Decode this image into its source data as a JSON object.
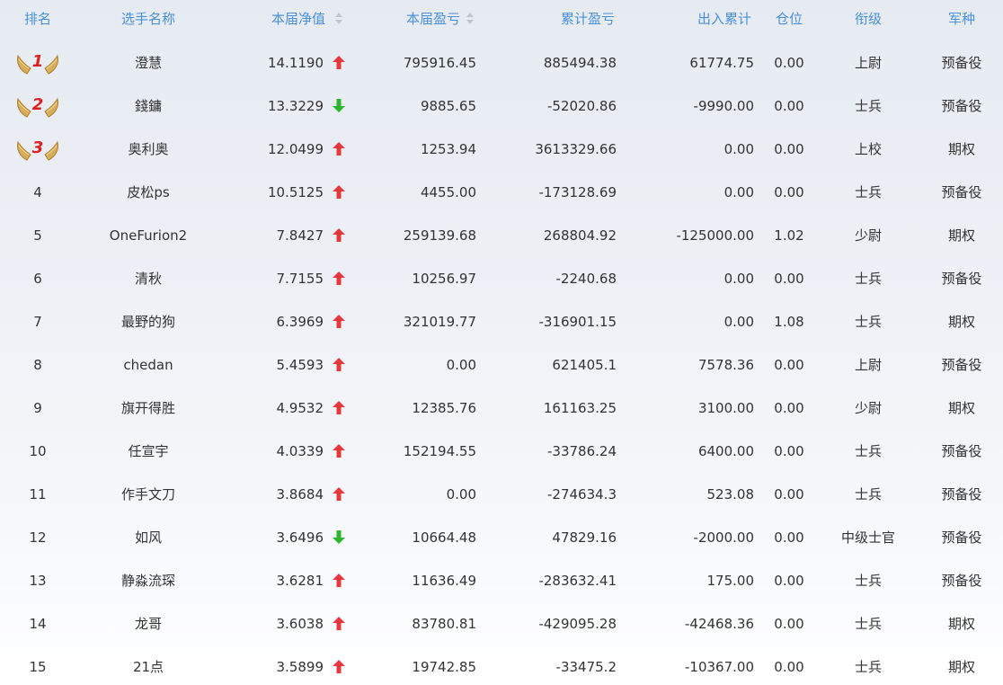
{
  "columns": {
    "rank": "排名",
    "name": "选手名称",
    "nav": "本届净值",
    "pl": "本届盈亏",
    "cum_pl": "累计盈亏",
    "io": "出入累计",
    "position": "仓位",
    "title": "衔级",
    "corps": "军种"
  },
  "colors": {
    "header_text": "#4a90d9",
    "up_arrow": "#e8383d",
    "down_arrow": "#2db52d",
    "medal_gold": "#c89a45",
    "medal_number": "#e02020"
  },
  "rows": [
    {
      "rank": "1",
      "name": "澄慧",
      "nav": "14.1190",
      "trend": "up",
      "pl": "795916.45",
      "cum_pl": "885494.38",
      "io": "61774.75",
      "position": "0.00",
      "title": "上尉",
      "corps": "预备役"
    },
    {
      "rank": "2",
      "name": "錢鏞",
      "nav": "13.3229",
      "trend": "down",
      "pl": "9885.65",
      "cum_pl": "-52020.86",
      "io": "-9990.00",
      "position": "0.00",
      "title": "士兵",
      "corps": "预备役"
    },
    {
      "rank": "3",
      "name": "奥利奥",
      "nav": "12.0499",
      "trend": "up",
      "pl": "1253.94",
      "cum_pl": "3613329.66",
      "io": "0.00",
      "position": "0.00",
      "title": "上校",
      "corps": "期权"
    },
    {
      "rank": "4",
      "name": "皮松ps",
      "nav": "10.5125",
      "trend": "up",
      "pl": "4455.00",
      "cum_pl": "-173128.69",
      "io": "0.00",
      "position": "0.00",
      "title": "士兵",
      "corps": "预备役"
    },
    {
      "rank": "5",
      "name": "OneFurion2",
      "nav": "7.8427",
      "trend": "up",
      "pl": "259139.68",
      "cum_pl": "268804.92",
      "io": "-125000.00",
      "position": "1.02",
      "title": "少尉",
      "corps": "期权"
    },
    {
      "rank": "6",
      "name": "清秋",
      "nav": "7.7155",
      "trend": "up",
      "pl": "10256.97",
      "cum_pl": "-2240.68",
      "io": "0.00",
      "position": "0.00",
      "title": "士兵",
      "corps": "预备役"
    },
    {
      "rank": "7",
      "name": "最野的狗",
      "nav": "6.3969",
      "trend": "up",
      "pl": "321019.77",
      "cum_pl": "-316901.15",
      "io": "0.00",
      "position": "1.08",
      "title": "士兵",
      "corps": "期权"
    },
    {
      "rank": "8",
      "name": "chedan",
      "nav": "5.4593",
      "trend": "up",
      "pl": "0.00",
      "cum_pl": "621405.1",
      "io": "7578.36",
      "position": "0.00",
      "title": "上尉",
      "corps": "预备役"
    },
    {
      "rank": "9",
      "name": "旗开得胜",
      "nav": "4.9532",
      "trend": "up",
      "pl": "12385.76",
      "cum_pl": "161163.25",
      "io": "3100.00",
      "position": "0.00",
      "title": "少尉",
      "corps": "期权"
    },
    {
      "rank": "10",
      "name": "任宣宇",
      "nav": "4.0339",
      "trend": "up",
      "pl": "152194.55",
      "cum_pl": "-33786.24",
      "io": "6400.00",
      "position": "0.00",
      "title": "士兵",
      "corps": "预备役"
    },
    {
      "rank": "11",
      "name": "作手文刀",
      "nav": "3.8684",
      "trend": "up",
      "pl": "0.00",
      "cum_pl": "-274634.3",
      "io": "523.08",
      "position": "0.00",
      "title": "士兵",
      "corps": "预备役"
    },
    {
      "rank": "12",
      "name": "如风",
      "nav": "3.6496",
      "trend": "down",
      "pl": "10664.48",
      "cum_pl": "47829.16",
      "io": "-2000.00",
      "position": "0.00",
      "title": "中级士官",
      "corps": "预备役"
    },
    {
      "rank": "13",
      "name": "静淼流琛",
      "nav": "3.6281",
      "trend": "up",
      "pl": "11636.49",
      "cum_pl": "-283632.41",
      "io": "175.00",
      "position": "0.00",
      "title": "士兵",
      "corps": "预备役"
    },
    {
      "rank": "14",
      "name": "龙哥",
      "nav": "3.6038",
      "trend": "up",
      "pl": "83780.81",
      "cum_pl": "-429095.28",
      "io": "-42468.36",
      "position": "0.00",
      "title": "士兵",
      "corps": "期权"
    },
    {
      "rank": "15",
      "name": "21点",
      "nav": "3.5899",
      "trend": "up",
      "pl": "19742.85",
      "cum_pl": "-33475.2",
      "io": "-10367.00",
      "position": "0.00",
      "title": "士兵",
      "corps": "期权"
    }
  ]
}
